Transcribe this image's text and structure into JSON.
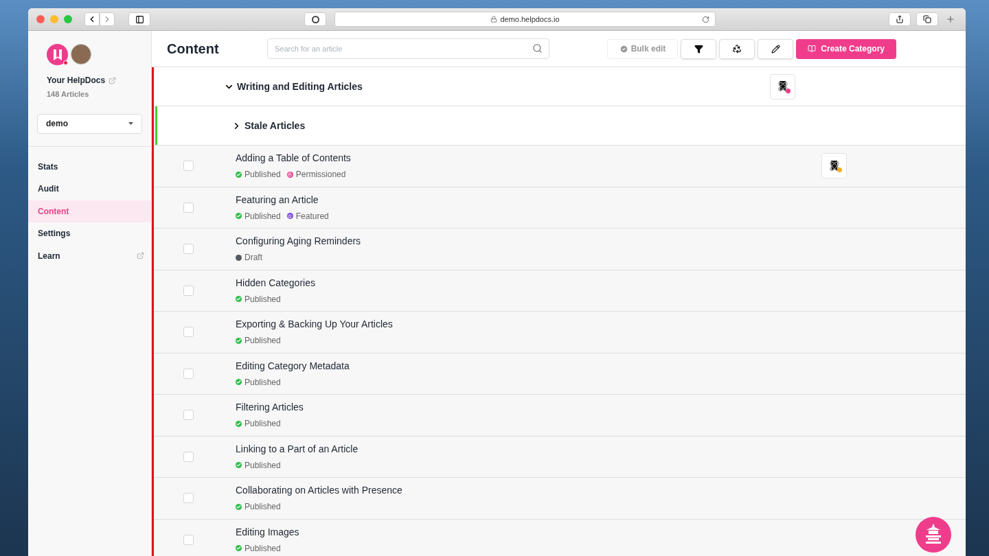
{
  "browser": {
    "url": "demo.helpdocs.io"
  },
  "sidebar": {
    "site_name": "Your HelpDocs",
    "article_count": "148 Articles",
    "workspace": "demo",
    "items": [
      {
        "label": "Stats",
        "selected": false,
        "external": false
      },
      {
        "label": "Audit",
        "selected": false,
        "external": false
      },
      {
        "label": "Content",
        "selected": true,
        "external": false
      },
      {
        "label": "Settings",
        "selected": false,
        "external": false
      },
      {
        "label": "Learn",
        "selected": false,
        "external": true
      }
    ]
  },
  "header": {
    "title": "Content",
    "search": {
      "placeholder": "Search for an article"
    },
    "bulk_edit": "Bulk edit",
    "create_button": "Create Category"
  },
  "categories": [
    {
      "name": "Writing and Editing Articles",
      "expanded": true,
      "color": "#e0101e",
      "presence": {
        "color": "#f03e8a"
      }
    },
    {
      "name": "Stale Articles",
      "expanded": false,
      "color": "#4cc93a"
    }
  ],
  "articles": [
    {
      "title": "Adding a Table of Contents",
      "checked": false,
      "presence": {
        "color": "#f0b020"
      },
      "statuses": [
        {
          "kind": "published",
          "label": "Published",
          "color": "#2fbf4a"
        },
        {
          "kind": "permissioned",
          "label": "Permissioned",
          "color": "#e8438a"
        }
      ]
    },
    {
      "title": "Featuring an Article",
      "checked": false,
      "statuses": [
        {
          "kind": "published",
          "label": "Published",
          "color": "#2fbf4a"
        },
        {
          "kind": "featured",
          "label": "Featured",
          "color": "#7b4fe0"
        }
      ]
    },
    {
      "title": "Configuring Aging Reminders",
      "checked": false,
      "statuses": [
        {
          "kind": "draft",
          "label": "Draft",
          "color": "#555a60"
        }
      ]
    },
    {
      "title": "Hidden Categories",
      "checked": false,
      "statuses": [
        {
          "kind": "published",
          "label": "Published",
          "color": "#2fbf4a"
        }
      ]
    },
    {
      "title": "Exporting & Backing Up Your Articles",
      "checked": false,
      "statuses": [
        {
          "kind": "published",
          "label": "Published",
          "color": "#2fbf4a"
        }
      ]
    },
    {
      "title": "Editing Category Metadata",
      "checked": false,
      "statuses": [
        {
          "kind": "published",
          "label": "Published",
          "color": "#2fbf4a"
        }
      ]
    },
    {
      "title": "Filtering Articles",
      "checked": false,
      "statuses": [
        {
          "kind": "published",
          "label": "Published",
          "color": "#2fbf4a"
        }
      ]
    },
    {
      "title": "Linking to a Part of an Article",
      "checked": false,
      "statuses": [
        {
          "kind": "published",
          "label": "Published",
          "color": "#2fbf4a"
        }
      ]
    },
    {
      "title": "Collaborating on Articles with Presence",
      "checked": false,
      "statuses": [
        {
          "kind": "published",
          "label": "Published",
          "color": "#2fbf4a"
        }
      ]
    },
    {
      "title": "Editing Images",
      "checked": false,
      "statuses": [
        {
          "kind": "published",
          "label": "Published",
          "color": "#2fbf4a"
        }
      ]
    }
  ]
}
